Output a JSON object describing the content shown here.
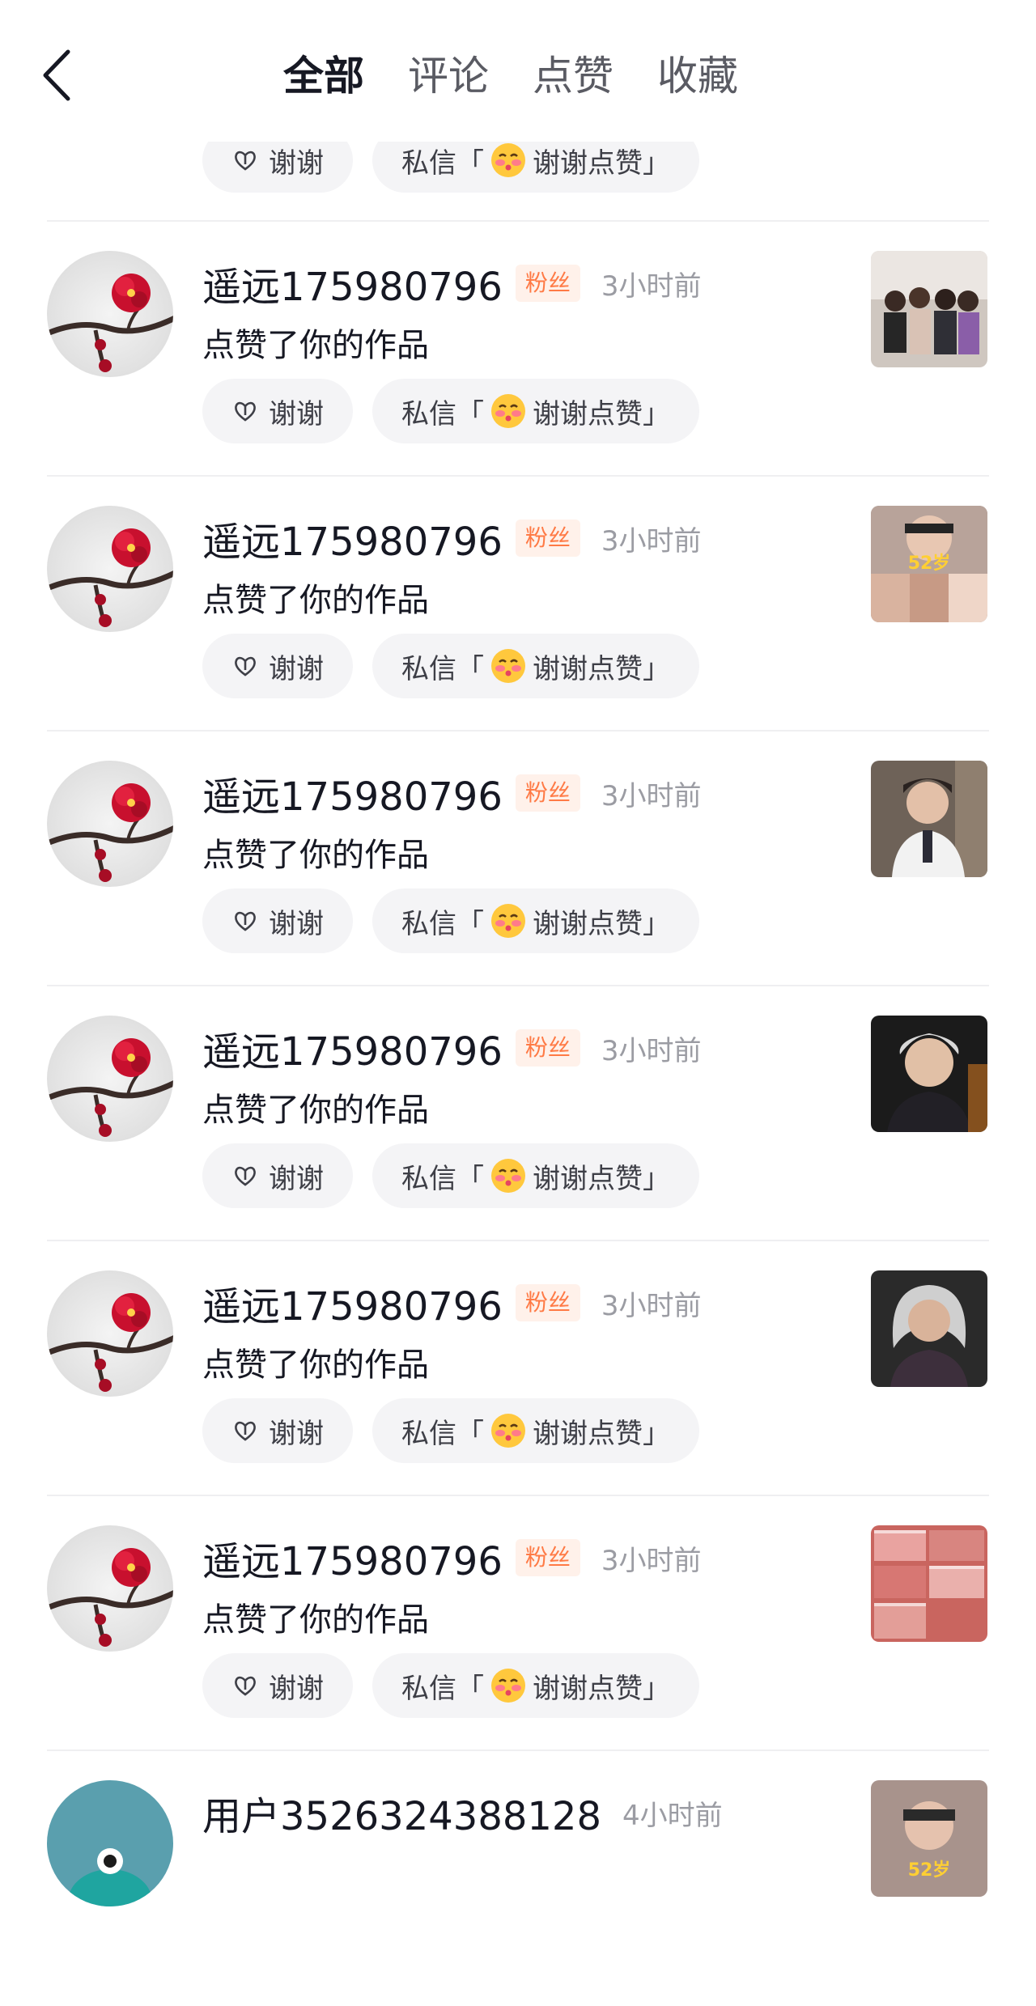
{
  "header": {
    "tabs": [
      {
        "label": "全部",
        "active": true
      },
      {
        "label": "评论",
        "active": false
      },
      {
        "label": "点赞",
        "active": false
      },
      {
        "label": "收藏",
        "active": false
      }
    ]
  },
  "top_partial": {
    "thanks_label": "谢谢",
    "dm_prefix": "私信「",
    "dm_text": "谢谢点赞」"
  },
  "notifications": [
    {
      "name": "遥远175980796",
      "badge": "粉丝",
      "time": "3小时前",
      "action": "点赞了你的作品",
      "thanks_label": "谢谢",
      "dm_prefix": "私信「",
      "dm_text": "谢谢点赞」",
      "thumb": "group-photo"
    },
    {
      "name": "遥远175980796",
      "badge": "粉丝",
      "time": "3小时前",
      "action": "点赞了你的作品",
      "thanks_label": "谢谢",
      "dm_prefix": "私信「",
      "dm_text": "谢谢点赞」",
      "thumb": "collage-52",
      "thumb_text": "52岁"
    },
    {
      "name": "遥远175980796",
      "badge": "粉丝",
      "time": "3小时前",
      "action": "点赞了你的作品",
      "thanks_label": "谢谢",
      "dm_prefix": "私信「",
      "dm_text": "谢谢点赞」",
      "thumb": "doctor-portrait"
    },
    {
      "name": "遥远175980796",
      "badge": "粉丝",
      "time": "3小时前",
      "action": "点赞了你的作品",
      "thanks_label": "谢谢",
      "dm_prefix": "私信「",
      "dm_text": "谢谢点赞」",
      "thumb": "elderly-woman-portrait"
    },
    {
      "name": "遥远175980796",
      "badge": "粉丝",
      "time": "3小时前",
      "action": "点赞了你的作品",
      "thanks_label": "谢谢",
      "dm_prefix": "私信「",
      "dm_text": "谢谢点赞」",
      "thumb": "grey-hair-portrait"
    },
    {
      "name": "遥远175980796",
      "badge": "粉丝",
      "time": "3小时前",
      "action": "点赞了你的作品",
      "thanks_label": "谢谢",
      "dm_prefix": "私信「",
      "dm_text": "谢谢点赞」",
      "thumb": "cash-stacks"
    }
  ],
  "partial_last": {
    "name": "用户3526324388128",
    "time": "4小时前",
    "thumb": "collage-52",
    "thumb_text": "52岁"
  },
  "colors": {
    "badge_bg": "#fff1ea",
    "badge_text": "#ff7a45",
    "pill_bg": "#f4f4f6",
    "avatar_teal": "#5a9fae"
  }
}
